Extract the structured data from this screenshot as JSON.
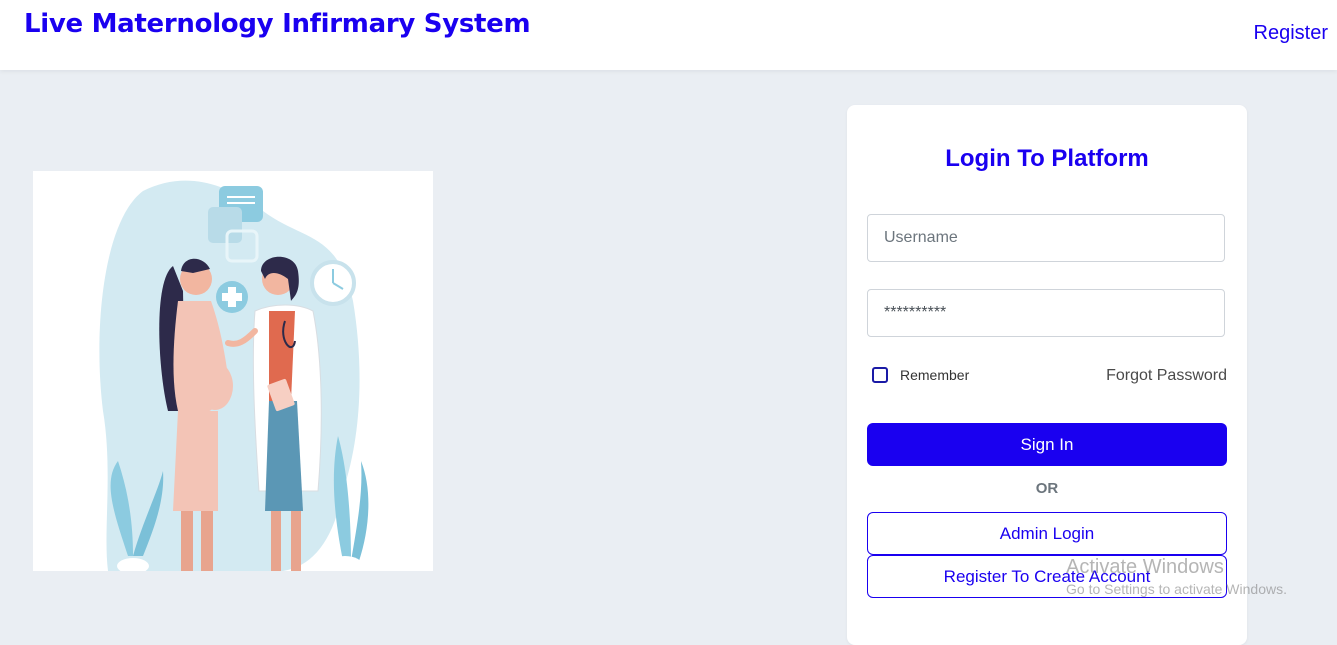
{
  "header": {
    "title": "Live Maternology Infirmary System",
    "register_label": "Register"
  },
  "illustration": {
    "name": "pregnant-woman-with-doctor-illustration"
  },
  "login": {
    "title": "Login To Platform",
    "username_placeholder": "Username",
    "password_value": "**********",
    "remember_label": "Remember",
    "forgot_label": "Forgot Password",
    "signin_label": "Sign In",
    "or_label": "OR",
    "admin_label": "Admin Login",
    "create_account_label": "Register To Create Account"
  },
  "watermark": {
    "title": "Activate Windows",
    "subtitle": "Go to Settings to activate Windows."
  },
  "colors": {
    "accent": "#1a00f0",
    "background": "#eaeef3"
  }
}
